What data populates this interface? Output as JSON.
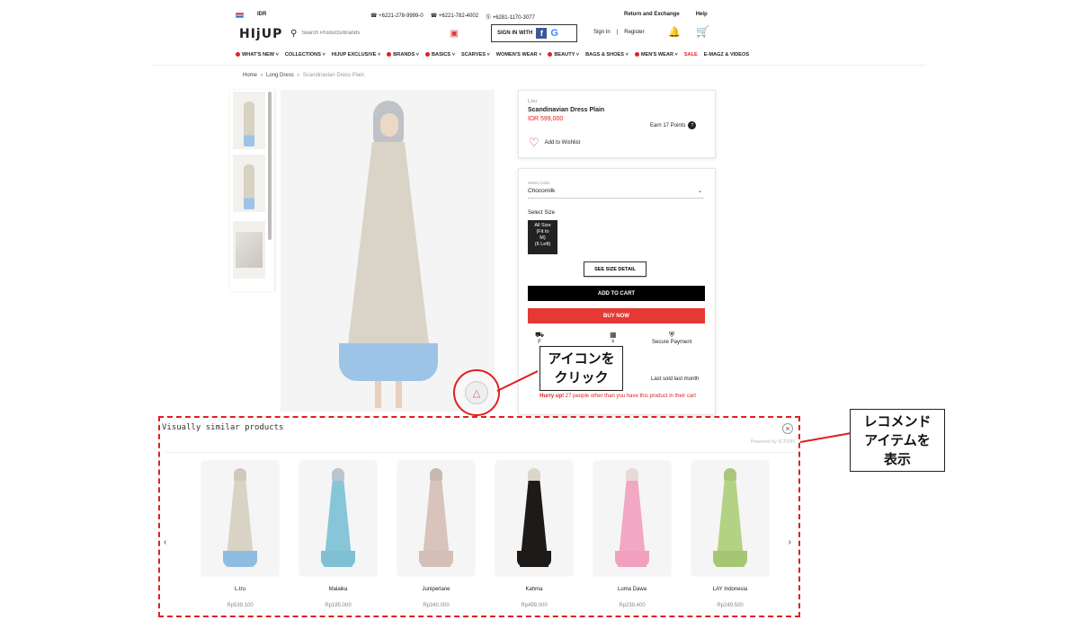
{
  "topbar": {
    "currency": "IDR",
    "phones": [
      "☎ +6221-278-9999-0",
      "☎ +6221-782-4002",
      "Ⓢ +6281-1170-3077"
    ],
    "return_label": "Return and Exchange",
    "help_label": "Help"
  },
  "header": {
    "logo": "HIjUP",
    "search_placeholder": "Search Products/Brands",
    "signin_with": "SIGN IN WITH",
    "signin_link": "Sign In",
    "divider": "|",
    "register_link": "Register"
  },
  "nav": [
    {
      "label": "WHAT'S NEW",
      "dot": true
    },
    {
      "label": "COLLECTIONS",
      "dot": false
    },
    {
      "label": "HIJUP EXCLUSIVE",
      "dot": false
    },
    {
      "label": "BRANDS",
      "dot": true
    },
    {
      "label": "BASICS",
      "dot": true
    },
    {
      "label": "SCARVES",
      "dot": false
    },
    {
      "label": "WOMEN'S WEAR",
      "dot": false
    },
    {
      "label": "BEAUTY",
      "dot": true
    },
    {
      "label": "BAGS & SHOES",
      "dot": false
    },
    {
      "label": "MEN'S WEAR",
      "dot": true
    },
    {
      "label": "SALE",
      "dot": false,
      "sale": true
    },
    {
      "label": "E-MAGZ & VIDEOS",
      "dot": false
    }
  ],
  "breadcrumb": {
    "home": "Home",
    "sep": "›",
    "category": "Long Dress",
    "current": "Scandinavian Dress Plain"
  },
  "product": {
    "brand": "L.tru",
    "name": "Scandinavian Dress Plain",
    "price": "IDR 599,000",
    "points": "Earn 17 Points",
    "points_badge": "?",
    "wishlist": "Add to Wishlist",
    "color_label": "Select Color",
    "color_value": "Chocomilk",
    "size_label": "Select Size",
    "size_option": [
      "All Size",
      "(Fit to",
      "M)",
      "(6 Left)"
    ],
    "size_detail_btn": "SEE SIZE DETAIL",
    "add_to_cart": "ADD TO CART",
    "buy_now": "BUY NOW",
    "features": [
      "F",
      "s",
      "Secure Payment"
    ],
    "last_sold": "Last sold last month",
    "hurry_prefix": "Hurry up!",
    "hurry_text": " 27 people other than you have this product in their cart"
  },
  "callouts": {
    "click_icon": [
      "アイコンを",
      "クリック"
    ],
    "show_recommended": [
      "レコメンド",
      "アイテムを",
      "表示"
    ]
  },
  "recommendations": {
    "title": "Visually similar products",
    "powered_by": "Powered by ICTION",
    "items": [
      {
        "name": "L.tru",
        "price": "Rp539.100",
        "colors": [
          "#cfc9bc",
          "#d9d3c6",
          "#8fbce3"
        ]
      },
      {
        "name": "Malaika",
        "price": "Rp185.000",
        "colors": [
          "#b9c5cf",
          "#86c6d8",
          "#7fc0d4"
        ]
      },
      {
        "name": "Juniperlane",
        "price": "Rp340.000",
        "colors": [
          "#c9b8b0",
          "#d8c3bd",
          "#d4bfb8"
        ]
      },
      {
        "name": "Kahma",
        "price": "Rp499.000",
        "colors": [
          "#ddd5c8",
          "#1e1a18",
          "#1e1a18"
        ]
      },
      {
        "name": "Luma Dawa",
        "price": "Rp239.400",
        "colors": [
          "#e9d9d6",
          "#f2a7c3",
          "#f2a0c0"
        ]
      },
      {
        "name": "LAY Indonesia",
        "price": "Rp249.500",
        "colors": [
          "#a9c77c",
          "#b4d283",
          "#a6c674"
        ]
      }
    ]
  },
  "colors": {
    "accent_red": "#e02020",
    "buy_now": "#e53935",
    "add_to_cart": "#000000"
  }
}
